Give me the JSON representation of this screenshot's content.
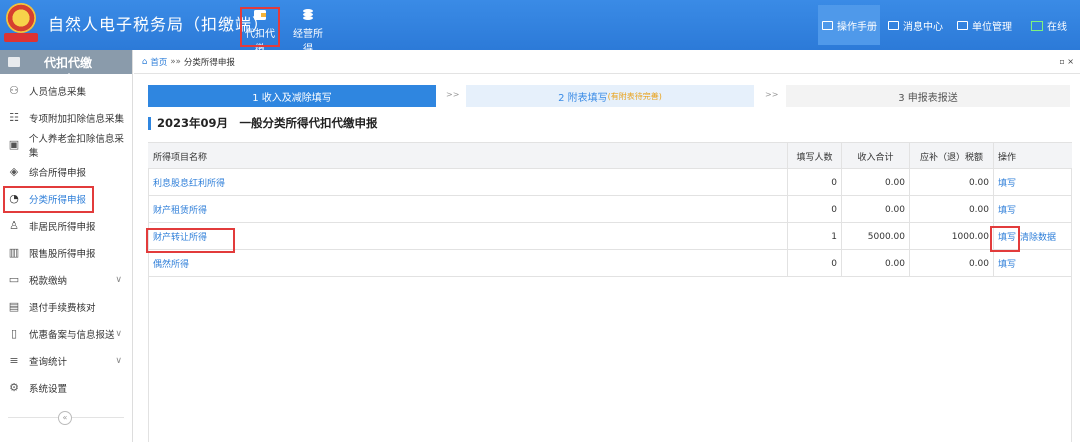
{
  "app": {
    "title": "自然人电子税务局（扣缴端）"
  },
  "topnav": {
    "items": [
      {
        "label": "代扣代缴",
        "icon": "wallet-icon"
      },
      {
        "label": "经营所得",
        "icon": "coins-icon"
      }
    ],
    "right": {
      "manual": "操作手册",
      "messages": "消息中心",
      "unit": "单位管理",
      "online": "在线"
    }
  },
  "sidebar": {
    "header": "代扣代缴",
    "items": [
      {
        "label": "人员信息采集"
      },
      {
        "label": "专项附加扣除信息采集"
      },
      {
        "label": "个人养老金扣除信息采集"
      },
      {
        "label": "综合所得申报"
      },
      {
        "label": "分类所得申报"
      },
      {
        "label": "非居民所得申报"
      },
      {
        "label": "限售股所得申报"
      },
      {
        "label": "税款缴纳"
      },
      {
        "label": "退付手续费核对"
      },
      {
        "label": "优惠备案与信息报送"
      },
      {
        "label": "查询统计"
      },
      {
        "label": "系统设置"
      }
    ],
    "collapse": "«"
  },
  "breadcrumb": {
    "home": "首页",
    "sep": "»»",
    "current": "分类所得申报",
    "ctrl": "▫ ×"
  },
  "steps": {
    "step1": "1 收入及减除填写",
    "step2": "2 附表填写",
    "step2_sub": "(有附表待完善)",
    "step3": "3 申报表报送",
    "arrow": ">>"
  },
  "section": {
    "title": "2023年09月　一般分类所得代扣代缴申报"
  },
  "table": {
    "headers": {
      "name": "所得项目名称",
      "count": "填写人数",
      "income": "收入合计",
      "tax": "应补（退）税额",
      "op": "操作"
    },
    "rows": [
      {
        "name": "利息股息红利所得",
        "count": "0",
        "income": "0.00",
        "tax": "0.00",
        "op1": "填写",
        "op2": ""
      },
      {
        "name": "财产租赁所得",
        "count": "0",
        "income": "0.00",
        "tax": "0.00",
        "op1": "填写",
        "op2": ""
      },
      {
        "name": "财产转让所得",
        "count": "1",
        "income": "5000.00",
        "tax": "1000.00",
        "op1": "填写",
        "op2": "清除数据"
      },
      {
        "name": "偶然所得",
        "count": "0",
        "income": "0.00",
        "tax": "0.00",
        "op1": "填写",
        "op2": ""
      }
    ]
  },
  "colors": {
    "topbar": "#2c7ad8",
    "accent": "#2f86e0",
    "highlight": "#e23b3b",
    "warn": "#e9a21b"
  }
}
